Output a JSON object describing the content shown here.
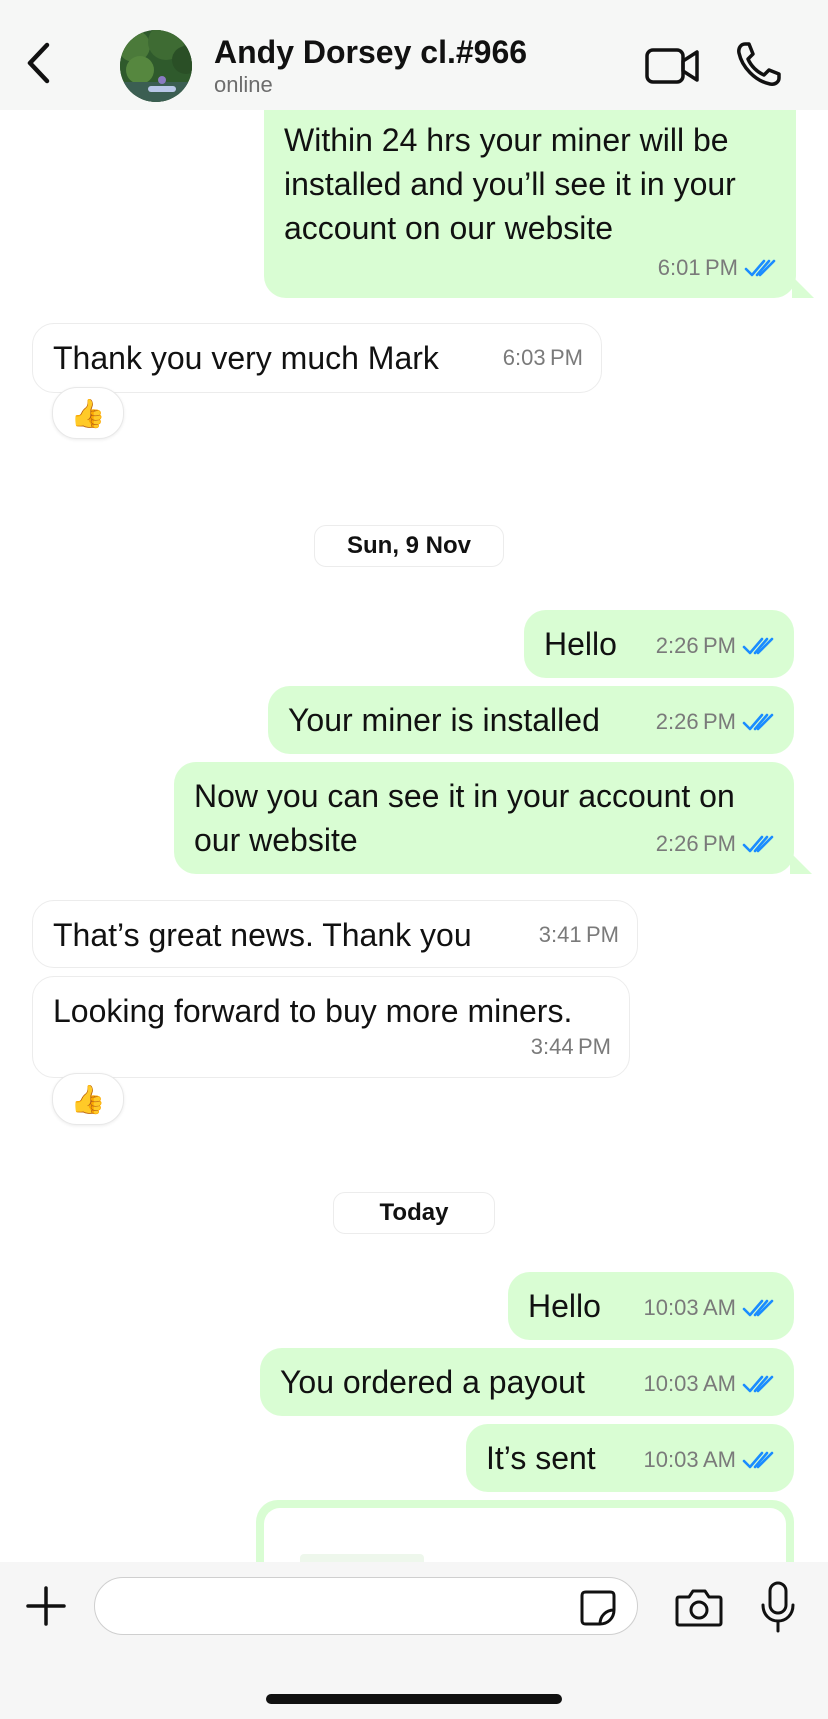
{
  "header": {
    "contact_name": "Andy Dorsey cl.#966",
    "status": "online"
  },
  "messages": [
    {
      "direction": "out",
      "text": "Within 24 hrs your miner will be installed and you’ll see it in your account on our website",
      "time": "6:01 PM",
      "read": true
    },
    {
      "direction": "in",
      "text": "Thank you very much Mark",
      "time": "6:03 PM",
      "reaction": "👍"
    },
    {
      "direction": "out",
      "text": "Hello",
      "time": "2:26 PM",
      "read": true
    },
    {
      "direction": "out",
      "text": "Your miner is installed",
      "time": "2:26 PM",
      "read": true
    },
    {
      "direction": "out",
      "text": "Now you can see it in your account on our website",
      "time": "2:26 PM",
      "read": true
    },
    {
      "direction": "in",
      "text": "That’s great news. Thank you",
      "time": "3:41 PM"
    },
    {
      "direction": "in",
      "text": "Looking forward to buy more miners.",
      "time": "3:44 PM",
      "reaction": "👍"
    },
    {
      "direction": "out",
      "text": "Hello",
      "time": "10:03 AM",
      "read": true
    },
    {
      "direction": "out",
      "text": "You ordered a payout",
      "time": "10:03 AM",
      "read": true
    },
    {
      "direction": "out",
      "text": "It’s sent",
      "time": "10:03 AM",
      "read": true
    }
  ],
  "date_separators": [
    "Sun, 9 Nov",
    "Today"
  ],
  "composer": {
    "placeholder": ""
  },
  "colors": {
    "outgoing_bubble": "#d9fdd3",
    "incoming_bubble": "#ffffff",
    "read_ticks": "#1a8cff"
  },
  "icons": [
    "back-chevron-icon",
    "video-camera-icon",
    "phone-icon",
    "plus-icon",
    "sticker-icon",
    "camera-icon",
    "microphone-icon",
    "double-check-icon"
  ]
}
